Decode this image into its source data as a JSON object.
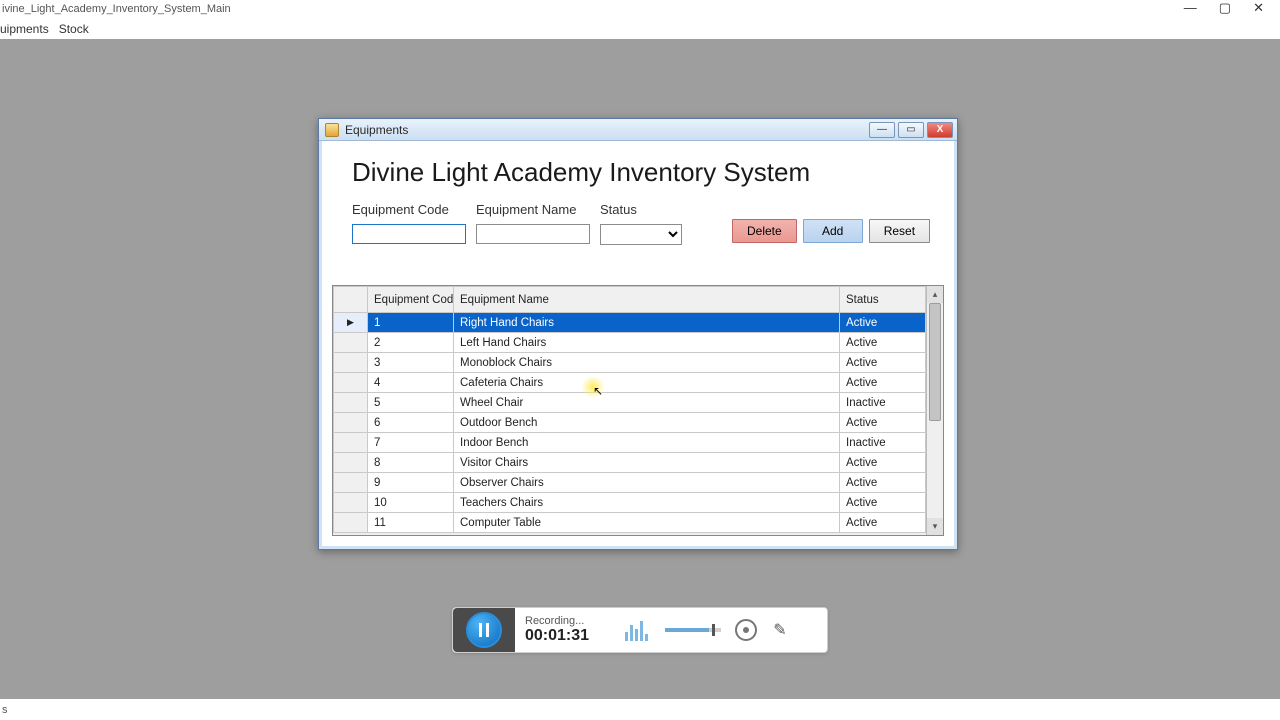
{
  "main_window": {
    "title": "ivine_Light_Academy_Inventory_System_Main",
    "controls": {
      "min": "—",
      "max": "▢",
      "close": "✕"
    }
  },
  "menu": {
    "equipments": "uipments",
    "stock": "Stock"
  },
  "statusbar": {
    "text": "s"
  },
  "child_window": {
    "title": "Equipments",
    "controls": {
      "min": "—",
      "max": "▭",
      "close": "X"
    },
    "app_heading": "Divine Light Academy Inventory System"
  },
  "form": {
    "code_label": "Equipment Code",
    "code_value": "",
    "name_label": "Equipment Name",
    "name_value": "",
    "status_label": "Status",
    "status_value": "",
    "buttons": {
      "delete": "Delete",
      "add": "Add",
      "reset": "Reset"
    }
  },
  "grid": {
    "headers": {
      "code": "Equipment Code",
      "name": "Equipment Name",
      "status": "Status"
    },
    "selected_marker": "▶",
    "rows": [
      {
        "code": "1",
        "name": "Right Hand Chairs",
        "status": "Active",
        "selected": true
      },
      {
        "code": "2",
        "name": "Left Hand Chairs",
        "status": "Active"
      },
      {
        "code": "3",
        "name": "Monoblock Chairs",
        "status": "Active"
      },
      {
        "code": "4",
        "name": "Cafeteria Chairs",
        "status": "Active"
      },
      {
        "code": "5",
        "name": "Wheel Chair",
        "status": "Inactive"
      },
      {
        "code": "6",
        "name": "Outdoor Bench",
        "status": "Active"
      },
      {
        "code": "7",
        "name": "Indoor Bench",
        "status": "Inactive"
      },
      {
        "code": "8",
        "name": "Visitor Chairs",
        "status": "Active"
      },
      {
        "code": "9",
        "name": "Observer Chairs",
        "status": "Active"
      },
      {
        "code": "10",
        "name": "Teachers Chairs",
        "status": "Active"
      },
      {
        "code": "11",
        "name": "Computer Table",
        "status": "Active"
      }
    ]
  },
  "recorder": {
    "label": "Recording...",
    "time": "00:01:31"
  }
}
